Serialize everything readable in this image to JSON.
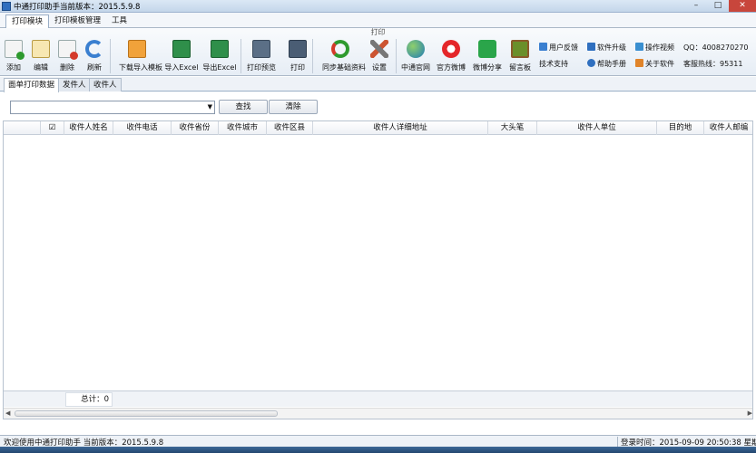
{
  "window": {
    "title": "中通打印助手当前版本：2015.5.9.8"
  },
  "menu": {
    "tabs": [
      "打印模块",
      "打印模板管理",
      "工具"
    ]
  },
  "ribbon": {
    "group_label": "打印",
    "buttons": {
      "add": "添加",
      "edit": "编辑",
      "delete": "删除",
      "refresh": "刷新",
      "download_import_template": "下载导入模板",
      "import_excel": "导入Excel",
      "export_excel": "导出Excel",
      "print_preview": "打印预览",
      "print": "打印",
      "sync_basic_data": "同步基础资料",
      "settings": "设置",
      "zto_website": "中通官网",
      "official_weibo": "官方微博",
      "weibo_share": "微博分享",
      "message_board": "留言板"
    },
    "links": {
      "user_feedback": "用户反馈",
      "tech_support": "技术支持",
      "software_upgrade": "软件升级",
      "help_manual": "帮助手册",
      "tutorial_video": "操作视频",
      "about": "关于软件",
      "qq": "QQ：4008270270",
      "hotline": "客服热线：95311"
    }
  },
  "content_tabs": [
    "面单打印数据",
    "发件人",
    "收件人"
  ],
  "search": {
    "value": "",
    "search_button": "查找",
    "clear_button": "清除"
  },
  "table": {
    "columns": [
      "",
      "☑",
      "收件人姓名",
      "收件电话",
      "收件省份",
      "收件城市",
      "收件区县",
      "收件人详细地址",
      "大头笔",
      "收件人单位",
      "目的地",
      "收件人邮编"
    ],
    "rows": []
  },
  "footer": {
    "total": "总计：0"
  },
  "status": {
    "left": "欢迎使用中通打印助手 当前版本：2015.5.9.8",
    "right": "登录时间：2015-09-09 20:50:38  星期三"
  },
  "colors": {
    "accent": "#2f6fbf",
    "close": "#c8463c"
  }
}
